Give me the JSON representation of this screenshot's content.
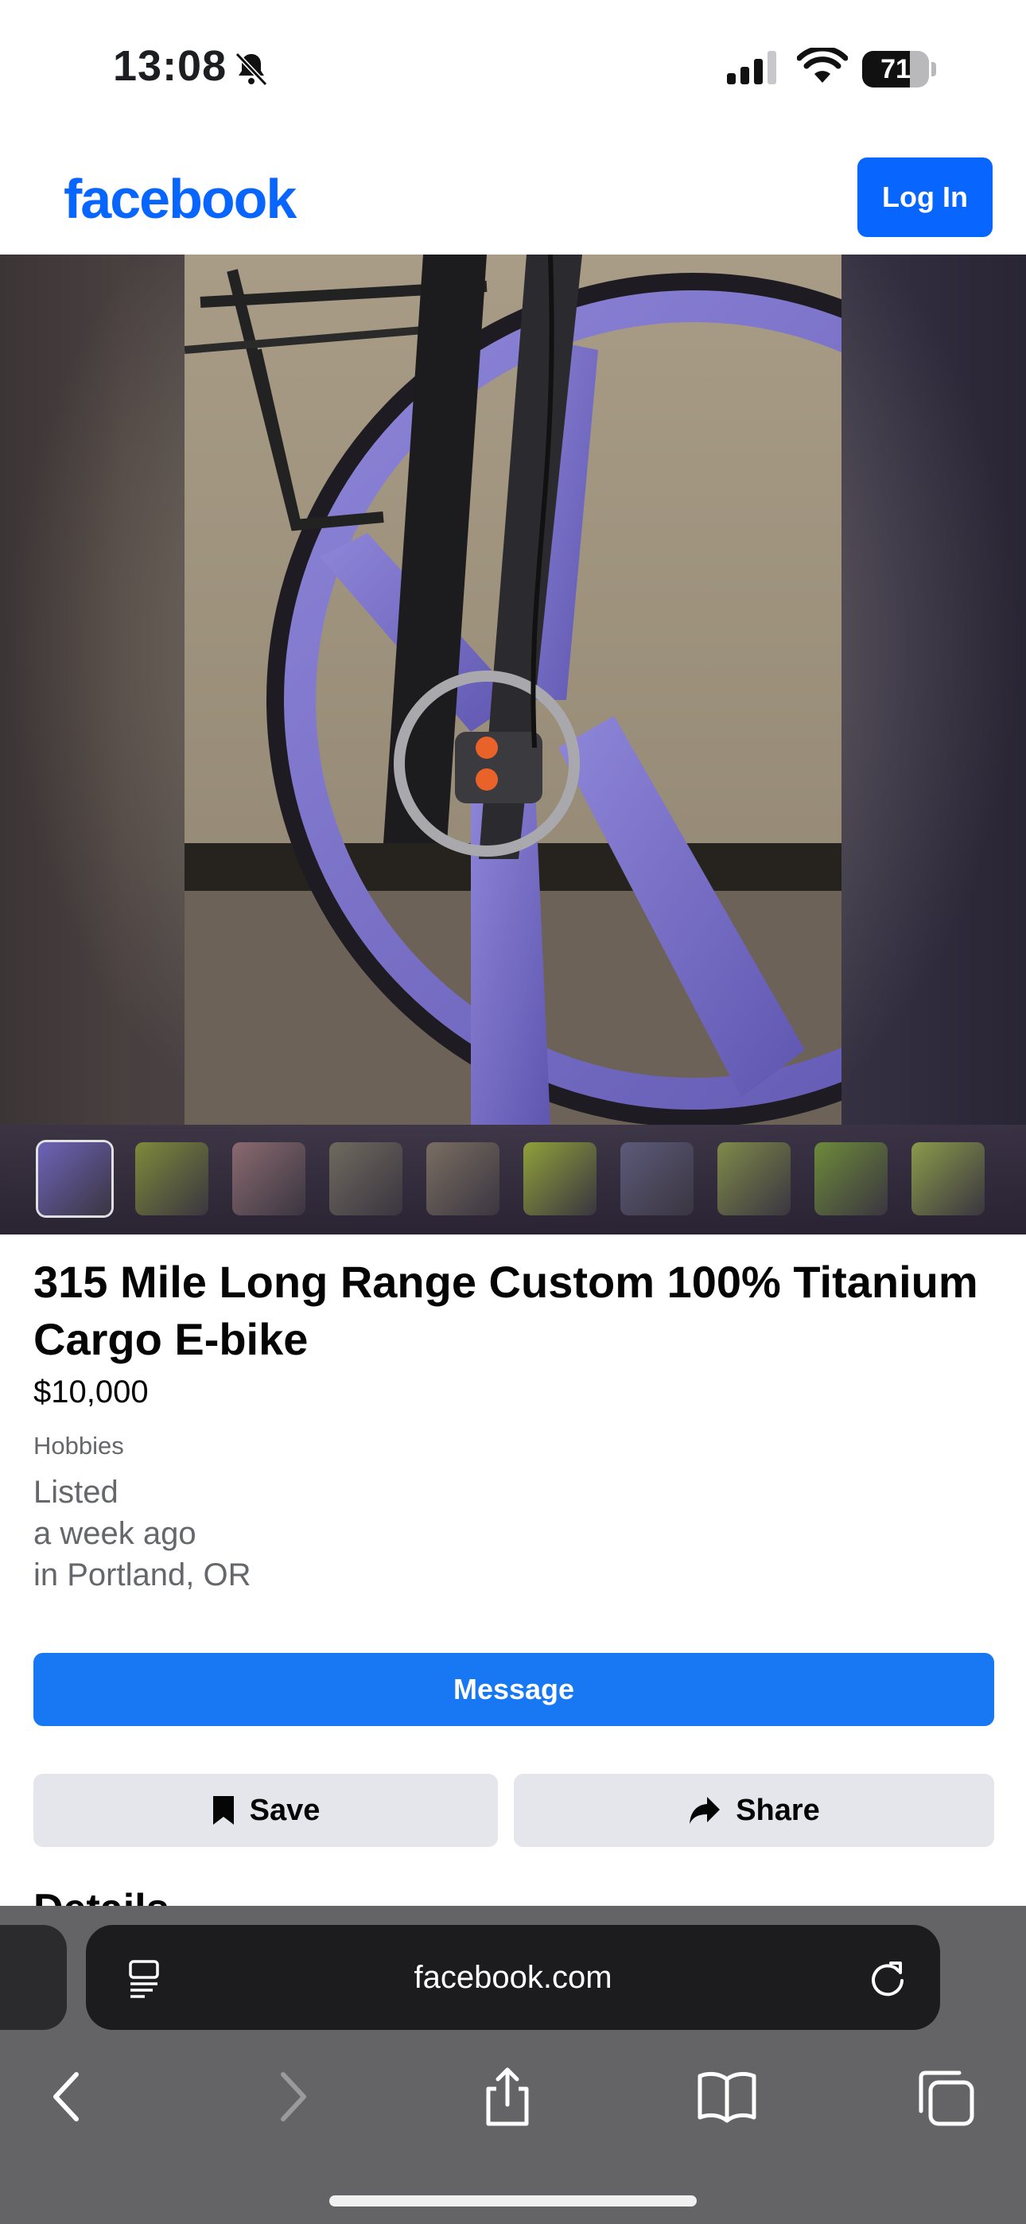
{
  "status": {
    "time": "13:08",
    "battery": "71",
    "battery_level": 0.71
  },
  "header": {
    "logo": "facebook",
    "login_label": "Log In"
  },
  "gallery": {
    "thumbnail_count": 10,
    "selected_index": 0
  },
  "listing": {
    "title": "315 Mile Long Range Custom 100% Titanium Cargo E-bike",
    "price": "$10,000",
    "category": "Hobbies",
    "listed_line1": "Listed",
    "listed_line2": "a week ago",
    "listed_line3": "in Portland, OR",
    "message_label": "Message",
    "save_label": "Save",
    "share_label": "Share",
    "details_heading": "Details"
  },
  "browser": {
    "url": "facebook.com"
  },
  "colors": {
    "facebook_blue": "#0866ff",
    "message_blue": "#1877f2",
    "button_gray": "#e4e6eb"
  }
}
